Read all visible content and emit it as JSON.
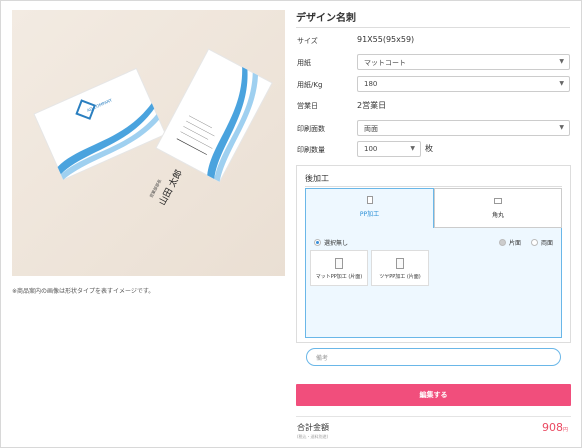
{
  "product": {
    "caption": "※商品案内の画像は形状タイプを表すイメージです。",
    "card_logo_text": "AD COMPANY",
    "card_name": "山田 太郎",
    "card_title": "営業部部長"
  },
  "title": "デザイン名刺",
  "fields": {
    "size_label": "サイズ",
    "size_value": "91X55(95x59)",
    "paper_label": "用紙",
    "paper_value": "マットコート",
    "weight_label": "用紙/Kg",
    "weight_value": "180",
    "business_days_label": "営業日",
    "business_days_value": "2営業日",
    "print_sides_label": "印刷面数",
    "print_sides_value": "両面",
    "quantity_label": "印刷数量",
    "quantity_value": "100",
    "quantity_unit": "枚"
  },
  "post_processing": {
    "title": "後加工",
    "tabs": [
      {
        "label": "PP加工",
        "icon": "portrait-card-icon"
      },
      {
        "label": "角丸",
        "icon": "landscape-card-icon"
      }
    ],
    "radios": {
      "none": "選択無し",
      "one_side": "片面",
      "both_sides": "両面"
    },
    "options": [
      {
        "label": "マットPP加工 (片面)"
      },
      {
        "label": "ツヤPP加工 (片面)"
      }
    ]
  },
  "remarks": {
    "placeholder": "備考"
  },
  "edit_button": "編集する",
  "total": {
    "label": "合計金額",
    "note": "(税込・送料別途)",
    "price": "908",
    "currency": "円"
  },
  "colors": {
    "accent_pink": "#f14e7c",
    "price_red": "#ea4a62",
    "selection_blue": "#6ab7e8"
  }
}
